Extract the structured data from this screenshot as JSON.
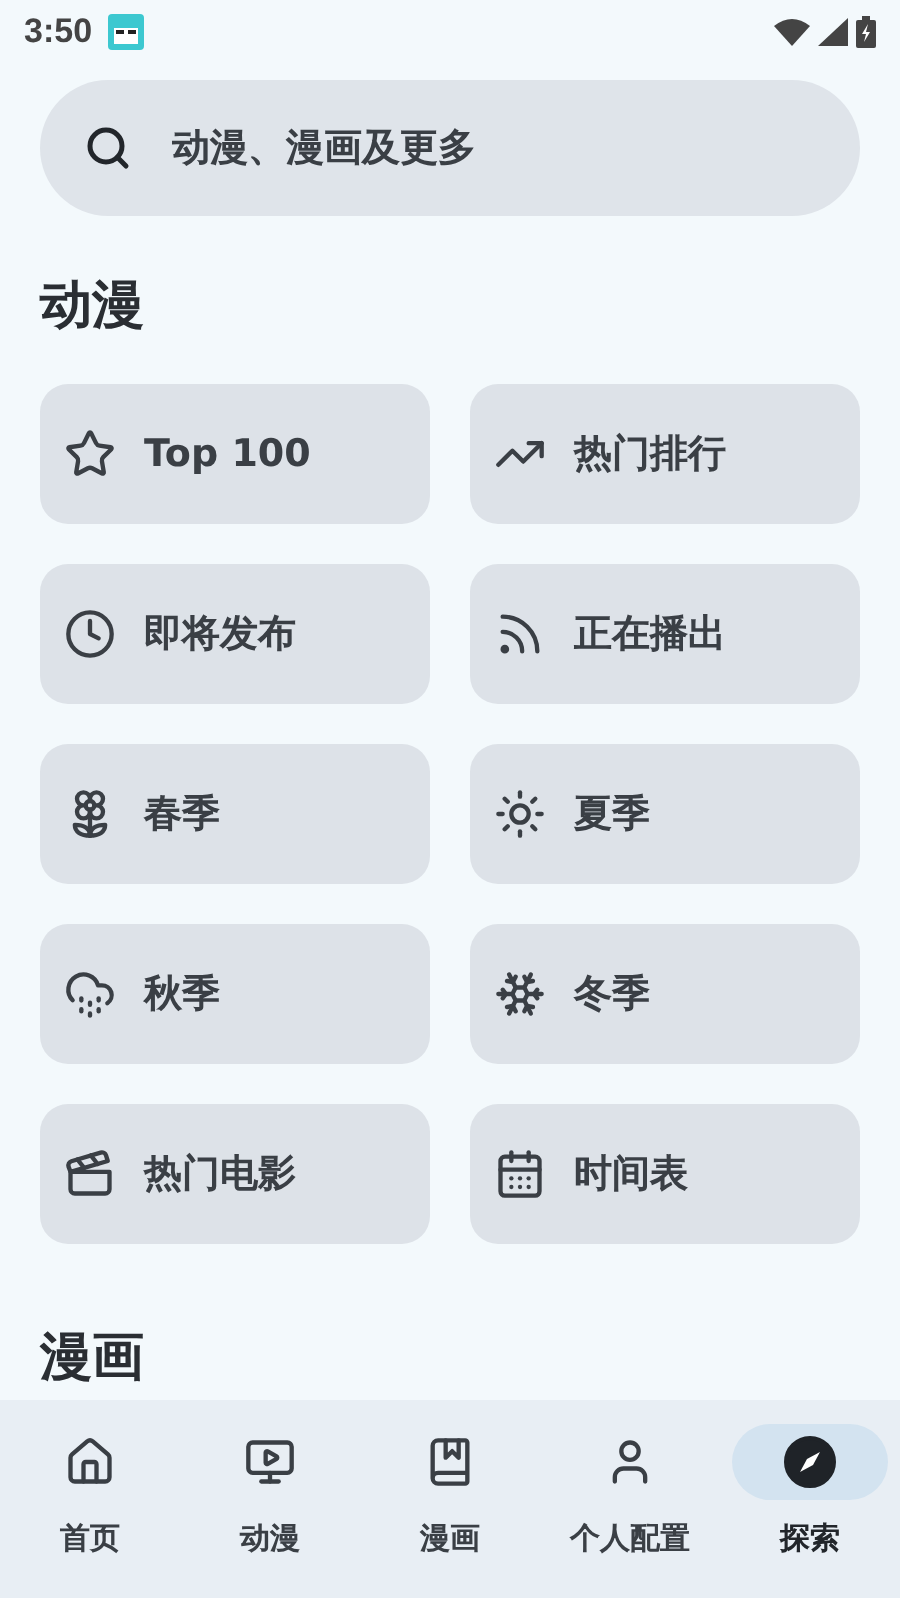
{
  "status_bar": {
    "time": "3:50"
  },
  "search": {
    "placeholder": "动漫、漫画及更多"
  },
  "sections": [
    {
      "title": "动漫",
      "items": [
        {
          "label": "Top 100"
        },
        {
          "label": "热门排行"
        },
        {
          "label": "即将发布"
        },
        {
          "label": "正在播出"
        },
        {
          "label": "春季"
        },
        {
          "label": "夏季"
        },
        {
          "label": "秋季"
        },
        {
          "label": "冬季"
        },
        {
          "label": "热门电影"
        },
        {
          "label": "时间表"
        }
      ]
    },
    {
      "title": "漫画"
    }
  ],
  "nav": [
    {
      "label": "首页",
      "selected": false
    },
    {
      "label": "动漫",
      "selected": false
    },
    {
      "label": "漫画",
      "selected": false
    },
    {
      "label": "个人配置",
      "selected": false
    },
    {
      "label": "探索",
      "selected": true
    }
  ]
}
